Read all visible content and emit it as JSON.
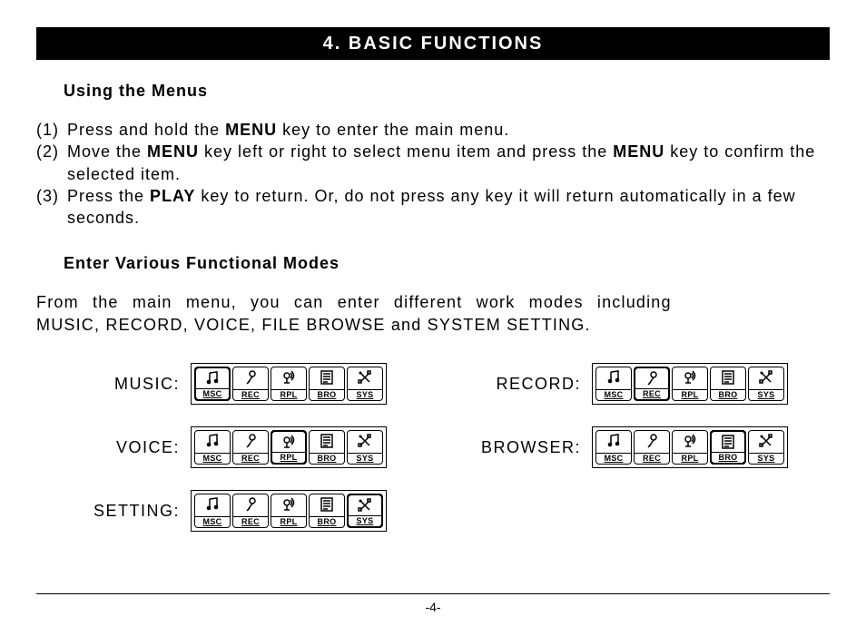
{
  "header": "4. BASIC FUNCTIONS",
  "subtitle1": "Using the Menus",
  "instructions": [
    {
      "num": "(1)",
      "html": "Press and hold the <b>MENU</b> key to enter the main menu."
    },
    {
      "num": "(2)",
      "html": "Move the <b>MENU</b> key left or right  to select menu item and press the <b>MENU</b> key to confirm the selected item."
    },
    {
      "num": "(3)",
      "html": "Press the <b>PLAY</b> key to return. Or, do not press any key it will return automatically in a few seconds."
    }
  ],
  "subtitle2": "Enter Various Functional Modes",
  "body_line1": "From the main menu, you can enter different work modes including",
  "body_line2": "MUSIC, RECORD, VOICE, FILE BROWSE and SYSTEM SETTING.",
  "icons": [
    {
      "code": "MSC",
      "glyph": "music"
    },
    {
      "code": "REC",
      "glyph": "mic"
    },
    {
      "code": "RPL",
      "glyph": "speak"
    },
    {
      "code": "BRO",
      "glyph": "list"
    },
    {
      "code": "SYS",
      "glyph": "tools"
    }
  ],
  "modes": [
    {
      "label": "MUSIC:",
      "selected": 0
    },
    {
      "label": "RECORD:",
      "selected": 1
    },
    {
      "label": "VOICE:",
      "selected": 2
    },
    {
      "label": "BROWSER:",
      "selected": 3
    },
    {
      "label": "SETTING:",
      "selected": 4
    }
  ],
  "page_number": "-4-"
}
